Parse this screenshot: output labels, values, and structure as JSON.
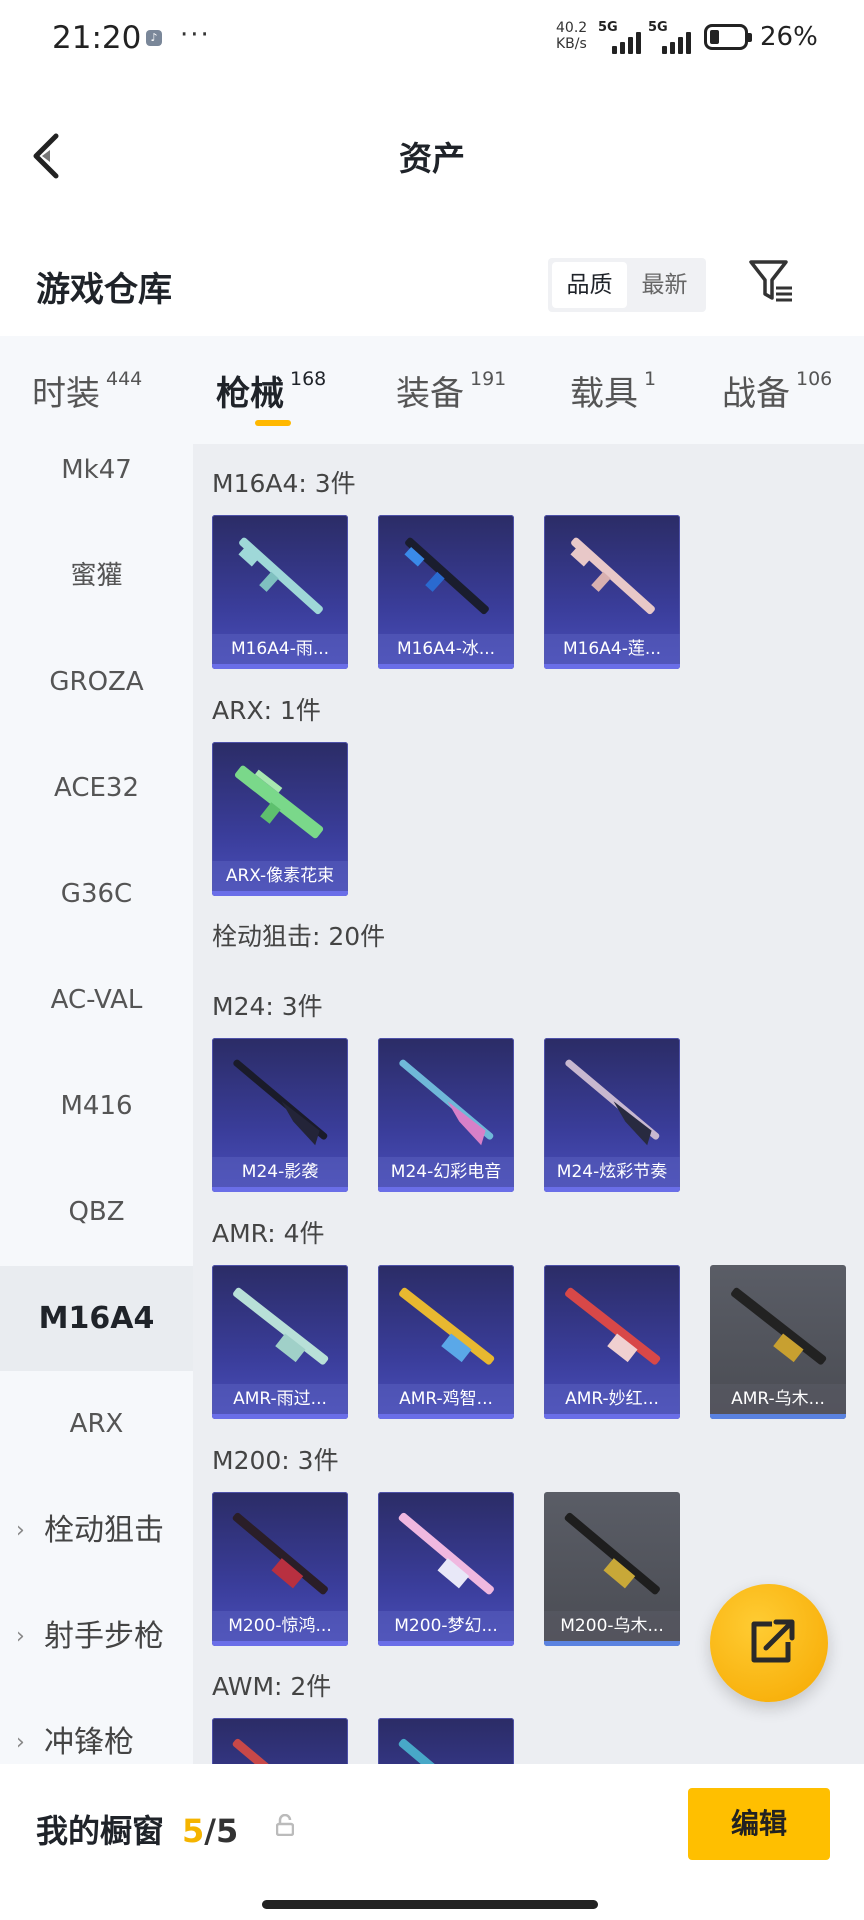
{
  "status_bar": {
    "time": "21:20",
    "net_speed_line1": "40.2",
    "net_speed_line2": "KB/s",
    "sim1": "5G",
    "sim2": "5G",
    "battery": "26%"
  },
  "header": {
    "title": "资产"
  },
  "warehouse": {
    "title": "游戏仓库",
    "sort_options": [
      "品质",
      "最新"
    ],
    "active_sort": "品质"
  },
  "tabs": [
    {
      "label": "时装",
      "count": "444"
    },
    {
      "label": "枪械",
      "count": "168"
    },
    {
      "label": "装备",
      "count": "191"
    },
    {
      "label": "载具",
      "count": "1"
    },
    {
      "label": "战备",
      "count": "106"
    }
  ],
  "active_tab": "枪械",
  "sidebar": {
    "items": [
      "Mk47",
      "蜜獾",
      "GROZA",
      "ACE32",
      "G36C",
      "AC-VAL",
      "M416",
      "QBZ",
      "M16A4",
      "ARX"
    ],
    "groups": [
      "栓动狙击",
      "射手步枪",
      "冲锋枪"
    ],
    "active": "M16A4"
  },
  "sections": {
    "m16a4": {
      "title": "M16A4: 3件",
      "cards": [
        "M16A4-雨...",
        "M16A4-冰...",
        "M16A4-莲..."
      ]
    },
    "arx": {
      "title": "ARX: 1件",
      "cards": [
        "ARX-像素花束"
      ]
    },
    "bolt_group": {
      "title": "栓动狙击: 20件"
    },
    "m24": {
      "title": "M24: 3件",
      "cards": [
        "M24-影袭",
        "M24-幻彩电音",
        "M24-炫彩节奏"
      ]
    },
    "amr": {
      "title": "AMR: 4件",
      "cards": [
        "AMR-雨过...",
        "AMR-鸡智...",
        "AMR-妙红...",
        "AMR-乌木..."
      ]
    },
    "m200": {
      "title": "M200: 3件",
      "cards": [
        "M200-惊鸿...",
        "M200-梦幻...",
        "M200-乌木..."
      ]
    },
    "awm": {
      "title": "AWM: 2件"
    }
  },
  "bottom": {
    "showcase_label": "我的橱窗",
    "current": "5",
    "total": "/5",
    "edit_label": "编辑"
  },
  "colors": {
    "accent": "#ffbf00",
    "card_bg": "#3a3d9a",
    "content_bg": "#eceef2"
  }
}
